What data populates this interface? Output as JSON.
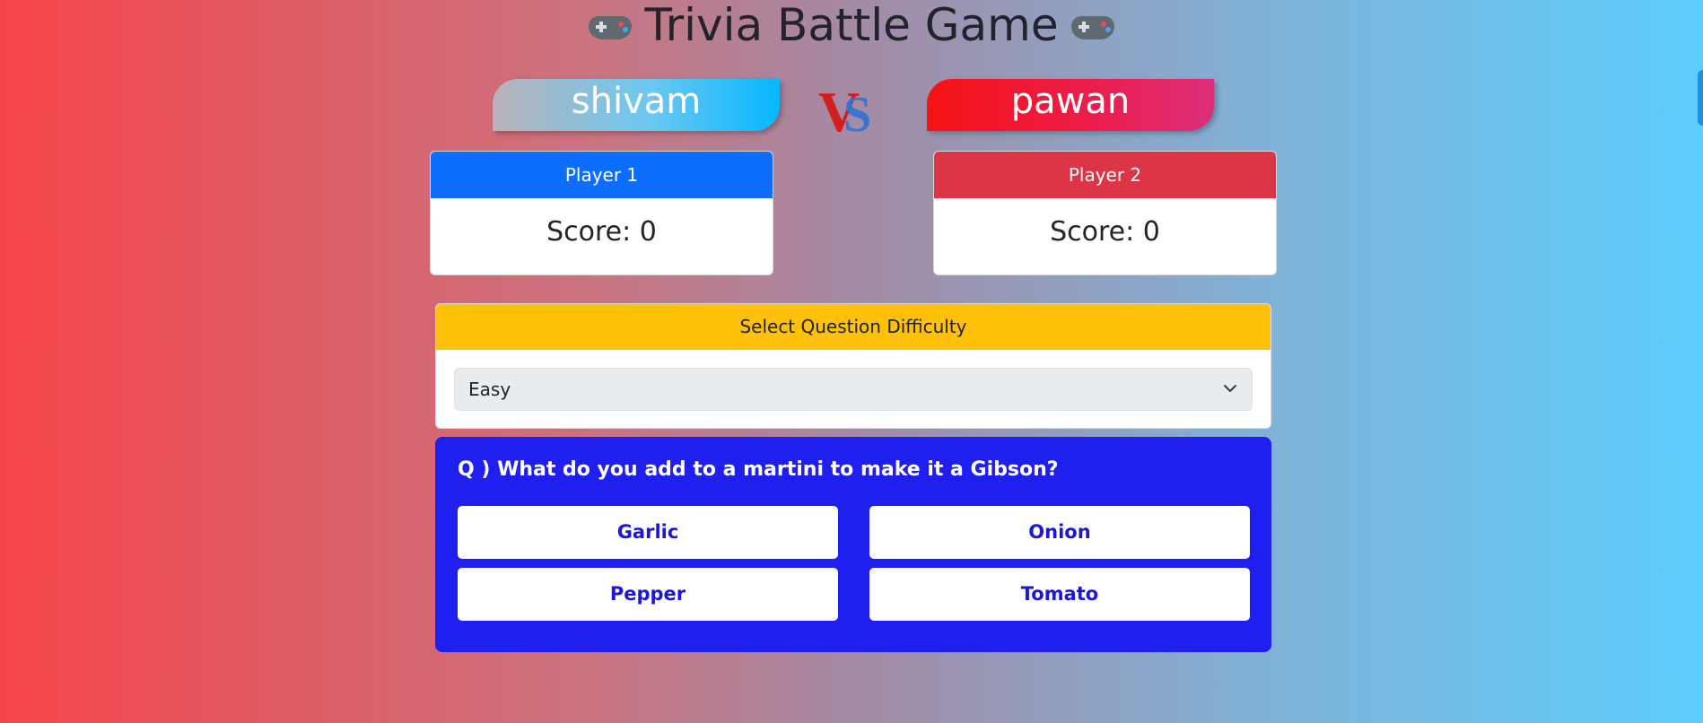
{
  "header": {
    "title": "Trivia Battle Game"
  },
  "players": {
    "p1_name": "shivam",
    "p2_name": "pawan",
    "vs_label": "VS",
    "p1_label": "Player 1",
    "p2_label": "Player 2",
    "p1_score": "Score: 0",
    "p2_score": "Score: 0"
  },
  "difficulty": {
    "header": "Select Question Difficulty",
    "selected": "Easy"
  },
  "quiz": {
    "question": "Q ) What do you add to a martini to make it a Gibson?",
    "options": [
      "Garlic",
      "Onion",
      "Pepper",
      "Tomato"
    ]
  },
  "colors": {
    "player1": "#0d6efd",
    "player2": "#dc3545",
    "difficulty": "#ffc107",
    "question_bg": "#1f1fef",
    "option_text": "#1c16d6"
  },
  "icons": {
    "title_left": "gamepad-icon",
    "title_right": "gamepad-icon",
    "select_chevron": "chevron-down-icon"
  }
}
